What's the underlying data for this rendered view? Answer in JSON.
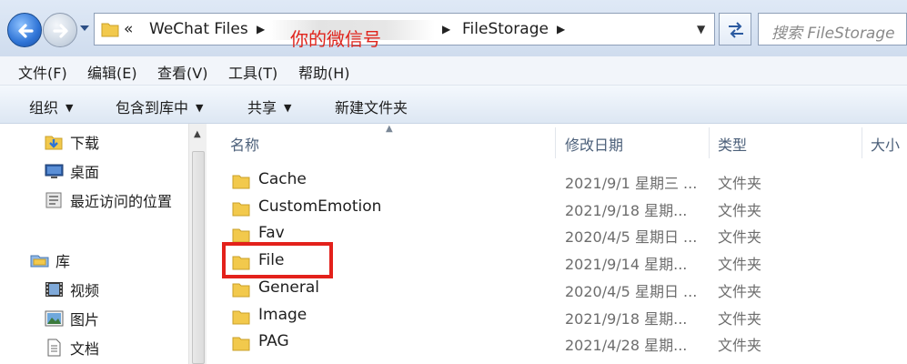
{
  "address_bar": {
    "overflow_chevron": "«",
    "crumbs": [
      "WeChat Files",
      "FileStorage"
    ],
    "annotation": "你的微信号",
    "search_placeholder": "搜索 FileStorage"
  },
  "menu": [
    "文件(F)",
    "编辑(E)",
    "查看(V)",
    "工具(T)",
    "帮助(H)"
  ],
  "toolbar": [
    "组织",
    "包含到库中",
    "共享",
    "新建文件夹"
  ],
  "nav_pane": {
    "items": [
      {
        "label": "下载",
        "icon": "download-folder-icon"
      },
      {
        "label": "桌面",
        "icon": "desktop-icon"
      },
      {
        "label": "最近访问的位置",
        "icon": "recent-places-icon"
      },
      {
        "label": "库",
        "icon": "library-icon"
      },
      {
        "label": "视频",
        "icon": "video-icon"
      },
      {
        "label": "图片",
        "icon": "picture-icon"
      },
      {
        "label": "文档",
        "icon": "document-icon"
      }
    ]
  },
  "file_list": {
    "columns": [
      "名称",
      "修改日期",
      "类型",
      "大小"
    ],
    "rows": [
      {
        "name": "Cache",
        "date": "2021/9/1 星期三 ...",
        "type": "文件夹"
      },
      {
        "name": "CustomEmotion",
        "date": "2021/9/18 星期...",
        "type": "文件夹"
      },
      {
        "name": "Fav",
        "date": "2020/4/5 星期日 ...",
        "type": "文件夹"
      },
      {
        "name": "File",
        "date": "2021/9/14 星期...",
        "type": "文件夹"
      },
      {
        "name": "General",
        "date": "2020/4/5 星期日 ...",
        "type": "文件夹"
      },
      {
        "name": "Image",
        "date": "2021/9/18 星期...",
        "type": "文件夹"
      },
      {
        "name": "PAG",
        "date": "2021/4/28 星期...",
        "type": "文件夹"
      }
    ]
  },
  "colors": {
    "highlight": "#e3211b",
    "annotation": "#e0241c",
    "folder": "#f2c94c"
  }
}
